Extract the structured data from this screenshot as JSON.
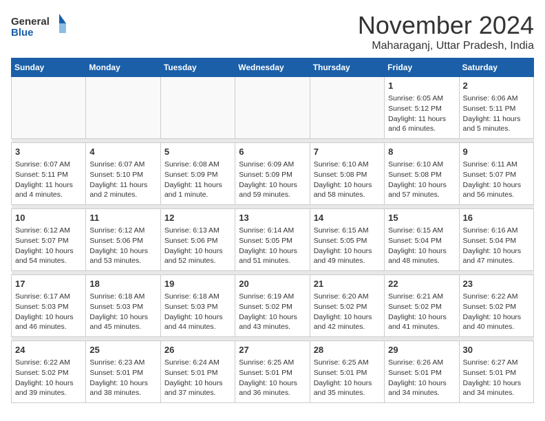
{
  "header": {
    "logo_general": "General",
    "logo_blue": "Blue",
    "month_title": "November 2024",
    "location": "Maharaganj, Uttar Pradesh, India"
  },
  "weekdays": [
    "Sunday",
    "Monday",
    "Tuesday",
    "Wednesday",
    "Thursday",
    "Friday",
    "Saturday"
  ],
  "weeks": [
    [
      {
        "day": "",
        "info": ""
      },
      {
        "day": "",
        "info": ""
      },
      {
        "day": "",
        "info": ""
      },
      {
        "day": "",
        "info": ""
      },
      {
        "day": "",
        "info": ""
      },
      {
        "day": "1",
        "info": "Sunrise: 6:05 AM\nSunset: 5:12 PM\nDaylight: 11 hours and 6 minutes."
      },
      {
        "day": "2",
        "info": "Sunrise: 6:06 AM\nSunset: 5:11 PM\nDaylight: 11 hours and 5 minutes."
      }
    ],
    [
      {
        "day": "3",
        "info": "Sunrise: 6:07 AM\nSunset: 5:11 PM\nDaylight: 11 hours and 4 minutes."
      },
      {
        "day": "4",
        "info": "Sunrise: 6:07 AM\nSunset: 5:10 PM\nDaylight: 11 hours and 2 minutes."
      },
      {
        "day": "5",
        "info": "Sunrise: 6:08 AM\nSunset: 5:09 PM\nDaylight: 11 hours and 1 minute."
      },
      {
        "day": "6",
        "info": "Sunrise: 6:09 AM\nSunset: 5:09 PM\nDaylight: 10 hours and 59 minutes."
      },
      {
        "day": "7",
        "info": "Sunrise: 6:10 AM\nSunset: 5:08 PM\nDaylight: 10 hours and 58 minutes."
      },
      {
        "day": "8",
        "info": "Sunrise: 6:10 AM\nSunset: 5:08 PM\nDaylight: 10 hours and 57 minutes."
      },
      {
        "day": "9",
        "info": "Sunrise: 6:11 AM\nSunset: 5:07 PM\nDaylight: 10 hours and 56 minutes."
      }
    ],
    [
      {
        "day": "10",
        "info": "Sunrise: 6:12 AM\nSunset: 5:07 PM\nDaylight: 10 hours and 54 minutes."
      },
      {
        "day": "11",
        "info": "Sunrise: 6:12 AM\nSunset: 5:06 PM\nDaylight: 10 hours and 53 minutes."
      },
      {
        "day": "12",
        "info": "Sunrise: 6:13 AM\nSunset: 5:06 PM\nDaylight: 10 hours and 52 minutes."
      },
      {
        "day": "13",
        "info": "Sunrise: 6:14 AM\nSunset: 5:05 PM\nDaylight: 10 hours and 51 minutes."
      },
      {
        "day": "14",
        "info": "Sunrise: 6:15 AM\nSunset: 5:05 PM\nDaylight: 10 hours and 49 minutes."
      },
      {
        "day": "15",
        "info": "Sunrise: 6:15 AM\nSunset: 5:04 PM\nDaylight: 10 hours and 48 minutes."
      },
      {
        "day": "16",
        "info": "Sunrise: 6:16 AM\nSunset: 5:04 PM\nDaylight: 10 hours and 47 minutes."
      }
    ],
    [
      {
        "day": "17",
        "info": "Sunrise: 6:17 AM\nSunset: 5:03 PM\nDaylight: 10 hours and 46 minutes."
      },
      {
        "day": "18",
        "info": "Sunrise: 6:18 AM\nSunset: 5:03 PM\nDaylight: 10 hours and 45 minutes."
      },
      {
        "day": "19",
        "info": "Sunrise: 6:18 AM\nSunset: 5:03 PM\nDaylight: 10 hours and 44 minutes."
      },
      {
        "day": "20",
        "info": "Sunrise: 6:19 AM\nSunset: 5:02 PM\nDaylight: 10 hours and 43 minutes."
      },
      {
        "day": "21",
        "info": "Sunrise: 6:20 AM\nSunset: 5:02 PM\nDaylight: 10 hours and 42 minutes."
      },
      {
        "day": "22",
        "info": "Sunrise: 6:21 AM\nSunset: 5:02 PM\nDaylight: 10 hours and 41 minutes."
      },
      {
        "day": "23",
        "info": "Sunrise: 6:22 AM\nSunset: 5:02 PM\nDaylight: 10 hours and 40 minutes."
      }
    ],
    [
      {
        "day": "24",
        "info": "Sunrise: 6:22 AM\nSunset: 5:02 PM\nDaylight: 10 hours and 39 minutes."
      },
      {
        "day": "25",
        "info": "Sunrise: 6:23 AM\nSunset: 5:01 PM\nDaylight: 10 hours and 38 minutes."
      },
      {
        "day": "26",
        "info": "Sunrise: 6:24 AM\nSunset: 5:01 PM\nDaylight: 10 hours and 37 minutes."
      },
      {
        "day": "27",
        "info": "Sunrise: 6:25 AM\nSunset: 5:01 PM\nDaylight: 10 hours and 36 minutes."
      },
      {
        "day": "28",
        "info": "Sunrise: 6:25 AM\nSunset: 5:01 PM\nDaylight: 10 hours and 35 minutes."
      },
      {
        "day": "29",
        "info": "Sunrise: 6:26 AM\nSunset: 5:01 PM\nDaylight: 10 hours and 34 minutes."
      },
      {
        "day": "30",
        "info": "Sunrise: 6:27 AM\nSunset: 5:01 PM\nDaylight: 10 hours and 34 minutes."
      }
    ]
  ]
}
